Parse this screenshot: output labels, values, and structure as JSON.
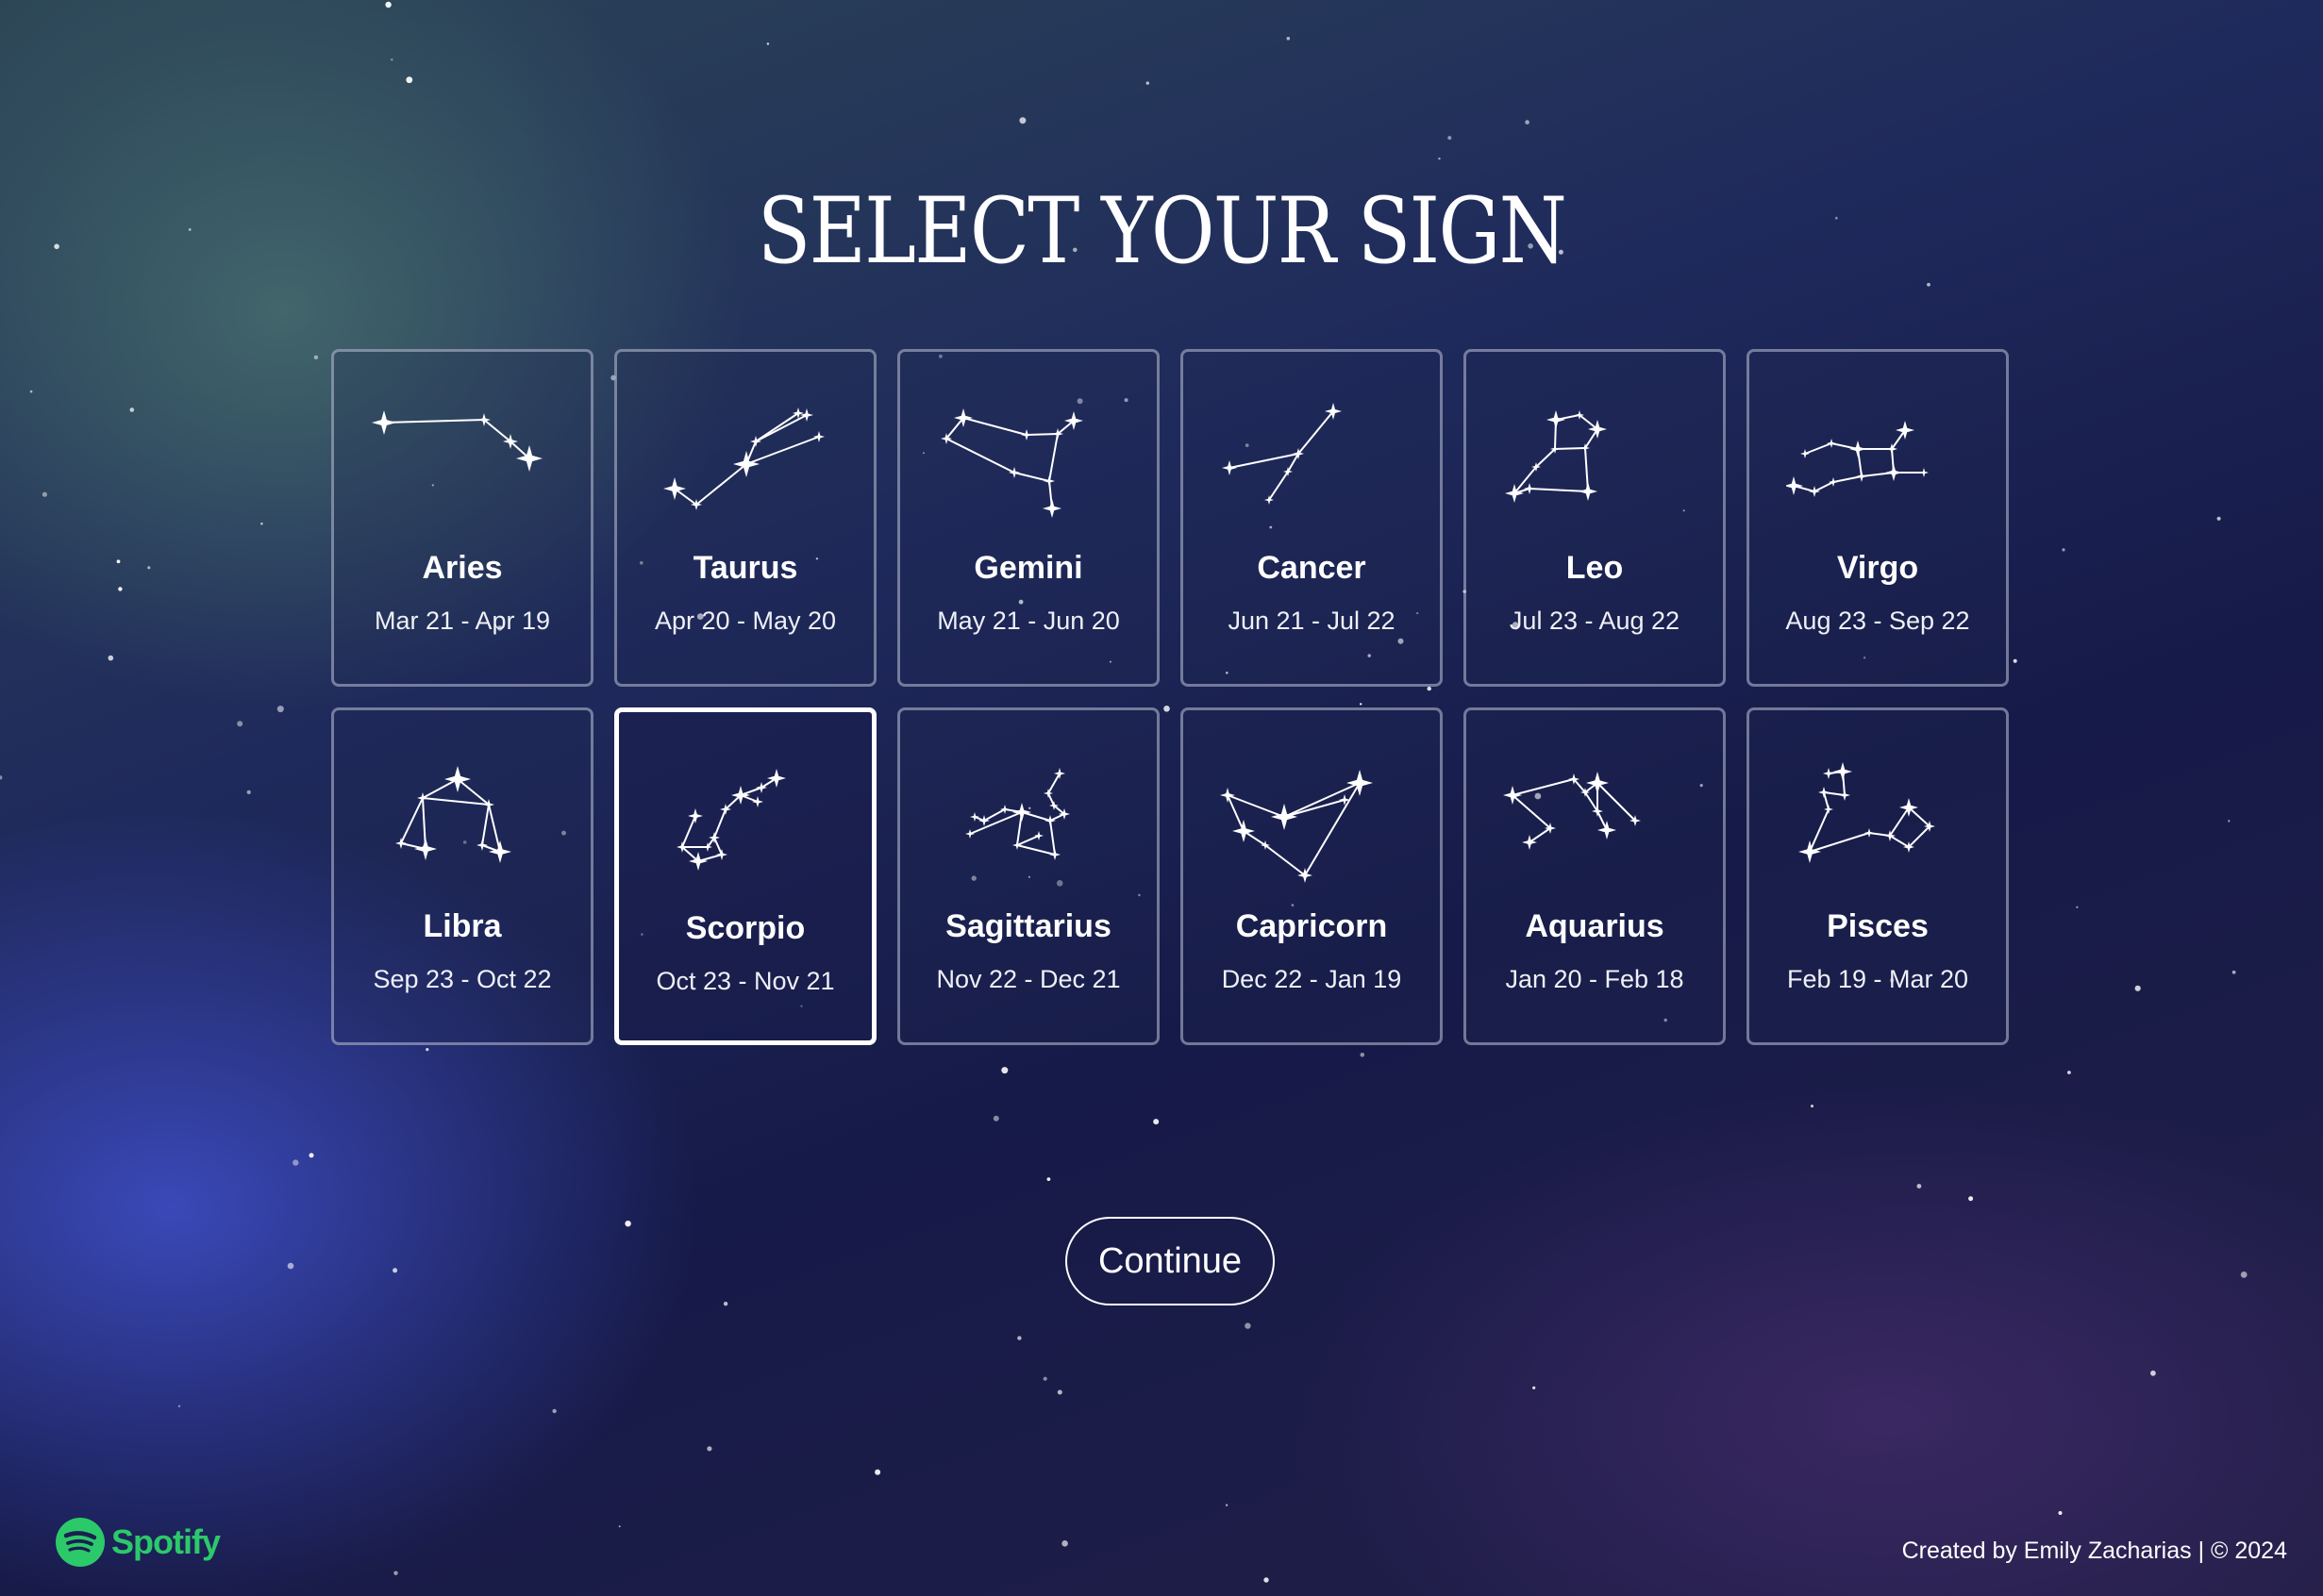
{
  "page": {
    "title": "SELECT YOUR SIGN",
    "continue_label": "Continue",
    "footer": "Created by Emily Zacharias | © 2024",
    "brand": "Spotify",
    "brand_color": "#1ed760",
    "background_accent": "#1b1f52",
    "selected_sign": "Scorpio"
  },
  "signs": [
    {
      "name": "Aries",
      "dates": "Mar 21 - Apr 19",
      "icon": "aries-constellation-icon"
    },
    {
      "name": "Taurus",
      "dates": "Apr 20 - May 20",
      "icon": "taurus-constellation-icon"
    },
    {
      "name": "Gemini",
      "dates": "May 21 - Jun 20",
      "icon": "gemini-constellation-icon"
    },
    {
      "name": "Cancer",
      "dates": "Jun 21 - Jul 22",
      "icon": "cancer-constellation-icon"
    },
    {
      "name": "Leo",
      "dates": "Jul 23 - Aug 22",
      "icon": "leo-constellation-icon"
    },
    {
      "name": "Virgo",
      "dates": "Aug 23 - Sep 22",
      "icon": "virgo-constellation-icon"
    },
    {
      "name": "Libra",
      "dates": "Sep 23 - Oct 22",
      "icon": "libra-constellation-icon"
    },
    {
      "name": "Scorpio",
      "dates": "Oct 23 - Nov 21",
      "icon": "scorpio-constellation-icon"
    },
    {
      "name": "Sagittarius",
      "dates": "Nov 22 - Dec 21",
      "icon": "sagittarius-constellation-icon"
    },
    {
      "name": "Capricorn",
      "dates": "Dec 22 - Jan 19",
      "icon": "capricorn-constellation-icon"
    },
    {
      "name": "Aquarius",
      "dates": "Jan 20 - Feb 18",
      "icon": "aquarius-constellation-icon"
    },
    {
      "name": "Pisces",
      "dates": "Feb 19 - Mar 20",
      "icon": "pisces-constellation-icon"
    }
  ]
}
